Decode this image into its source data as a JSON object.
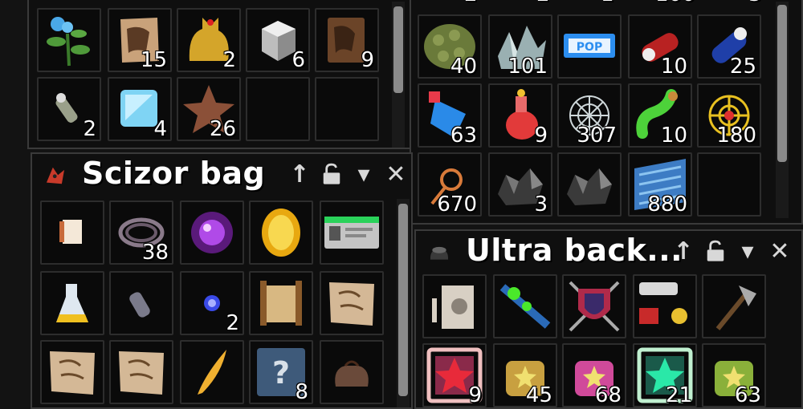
{
  "windows": {
    "top_left": {
      "slots_row1": [
        {
          "icon": "blue-flower-plant-icon",
          "qty": ""
        },
        {
          "icon": "tattered-parchment-icon",
          "qty": "15"
        },
        {
          "icon": "golden-cat-statue-icon",
          "qty": "2"
        },
        {
          "icon": "silver-cube-icon",
          "qty": "6"
        },
        {
          "icon": "brown-book-icon",
          "qty": "9"
        }
      ],
      "slots_row2": [
        {
          "icon": "small-vial-icon",
          "qty": "2"
        },
        {
          "icon": "ice-cube-icon",
          "qty": "4"
        },
        {
          "icon": "bronze-star-icon",
          "qty": "26"
        },
        {
          "icon": "empty",
          "qty": ""
        },
        {
          "icon": "empty",
          "qty": ""
        }
      ]
    },
    "top_right": {
      "top_partial": [
        "2",
        "2",
        "1",
        "100",
        "3"
      ],
      "rows": [
        [
          {
            "icon": "green-seed-pod-icon",
            "qty": "40"
          },
          {
            "icon": "crystal-shards-icon",
            "qty": "101"
          },
          {
            "icon": "pop-ticket-icon",
            "qty": ""
          },
          {
            "icon": "red-capsule-icon",
            "qty": "10"
          },
          {
            "icon": "blue-capsule-icon",
            "qty": "25"
          }
        ],
        [
          {
            "icon": "blue-potion-icon",
            "qty": "63"
          },
          {
            "icon": "red-potion-icon",
            "qty": "9"
          },
          {
            "icon": "spider-web-icon",
            "qty": "307"
          },
          {
            "icon": "green-potion-icon",
            "qty": "10"
          },
          {
            "icon": "golden-web-icon",
            "qty": "180"
          }
        ],
        [
          {
            "icon": "magnifier-icon",
            "qty": "670"
          },
          {
            "icon": "dark-rocks-icon",
            "qty": "3"
          },
          {
            "icon": "dark-rubble-icon",
            "qty": ""
          },
          {
            "icon": "blue-scales-icon",
            "qty": "880"
          },
          {
            "icon": "empty",
            "qty": ""
          }
        ]
      ]
    },
    "scizor": {
      "title": "Scizor bag",
      "rows": [
        [
          {
            "icon": "note-card-icon",
            "qty": ""
          },
          {
            "icon": "rope-coil-icon",
            "qty": "38"
          },
          {
            "icon": "purple-orb-icon",
            "qty": ""
          },
          {
            "icon": "golden-gem-icon",
            "qty": ""
          },
          {
            "icon": "id-card-icon",
            "qty": ""
          }
        ],
        [
          {
            "icon": "yellow-flask-icon",
            "qty": ""
          },
          {
            "icon": "grey-tube-icon",
            "qty": ""
          },
          {
            "icon": "blue-spark-icon",
            "qty": "2"
          },
          {
            "icon": "ancient-scroll-icon",
            "qty": ""
          },
          {
            "icon": "parchment-map-icon",
            "qty": ""
          }
        ],
        [
          {
            "icon": "parchment-map-icon",
            "qty": ""
          },
          {
            "icon": "parchment-map-icon",
            "qty": ""
          },
          {
            "icon": "golden-feather-icon",
            "qty": ""
          },
          {
            "icon": "mystery-box-icon",
            "qty": "8"
          },
          {
            "icon": "brown-pouch-icon",
            "qty": ""
          }
        ]
      ]
    },
    "ultra": {
      "title": "Ultra back...",
      "rows": [
        [
          {
            "icon": "speaker-device-icon",
            "qty": ""
          },
          {
            "icon": "multi-tool-icon",
            "qty": ""
          },
          {
            "icon": "shield-swords-icon",
            "qty": ""
          },
          {
            "icon": "machine-parts-icon",
            "qty": ""
          },
          {
            "icon": "axe-icon",
            "qty": ""
          }
        ],
        [
          {
            "icon": "red-star-badge-icon",
            "qty": "9"
          },
          {
            "icon": "gold-star-bag-icon",
            "qty": "45"
          },
          {
            "icon": "pink-star-bag-icon",
            "qty": "68"
          },
          {
            "icon": "green-star-badge-icon",
            "qty": "21"
          },
          {
            "icon": "green-star-bag-icon",
            "qty": "63"
          }
        ]
      ]
    }
  },
  "controls": {
    "move_up": "↑",
    "minimize": "▾",
    "close": "✕"
  },
  "colors": {
    "panel_bg": "#0f0f0f",
    "slot_border": "#2d2d2d",
    "text": "#ffffff"
  }
}
